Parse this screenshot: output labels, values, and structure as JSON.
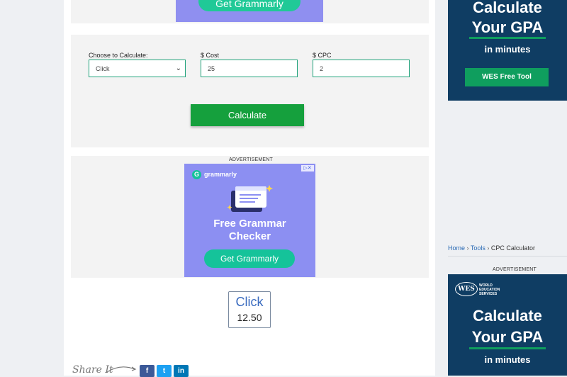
{
  "top_ad": {
    "cta": "Get Grammarly"
  },
  "form": {
    "calc_label": "Choose to Calculate:",
    "calc_value": "Click",
    "cost_label": "$ Cost",
    "cost_value": "25",
    "cpc_label": "$ CPC",
    "cpc_value": "2",
    "button_label": "Calculate"
  },
  "ad_grammarly": {
    "advert_label": "ADVERTISEMENT",
    "brand": "grammarly",
    "headline_line1": "Free Grammar",
    "headline_line2": "Checker",
    "cta": "Get Grammarly"
  },
  "result": {
    "label": "Click",
    "value": "12.50"
  },
  "share": {
    "text": "Share It",
    "facebook": "f",
    "twitter": "t",
    "linkedin": "in"
  },
  "sidebar": {
    "top_ad": {
      "line1": "Calculate",
      "line2": "Your GPA",
      "line3": "in minutes",
      "button": "WES Free Tool"
    },
    "breadcrumb": {
      "home": "Home",
      "tools": "Tools",
      "current": "CPC Calculator",
      "separator": "›"
    },
    "advert_label": "ADVERTISEMENT",
    "bottom_ad": {
      "brand_abbr": "WES",
      "brand_line1": "WORLD",
      "brand_line2": "EDUCATION",
      "brand_line3": "SERVICES",
      "line1": "Calculate",
      "line2": "Your GPA",
      "line3": "in minutes"
    }
  },
  "colors": {
    "accent_green": "#15a03d",
    "wes_navy": "#0f3d63",
    "grammarly_purple": "#8c8ff2",
    "grammarly_green": "#15c39a"
  }
}
